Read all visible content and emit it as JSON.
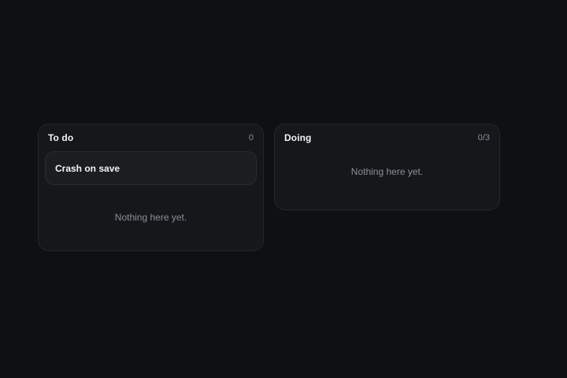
{
  "board": {
    "columns": [
      {
        "title": "To do",
        "count": "0",
        "cards": [
          {
            "title": "Crash on save"
          }
        ],
        "empty_text": "Nothing here yet."
      },
      {
        "title": "Doing",
        "count": "0/3",
        "cards": [],
        "empty_text": "Nothing here yet."
      }
    ]
  }
}
